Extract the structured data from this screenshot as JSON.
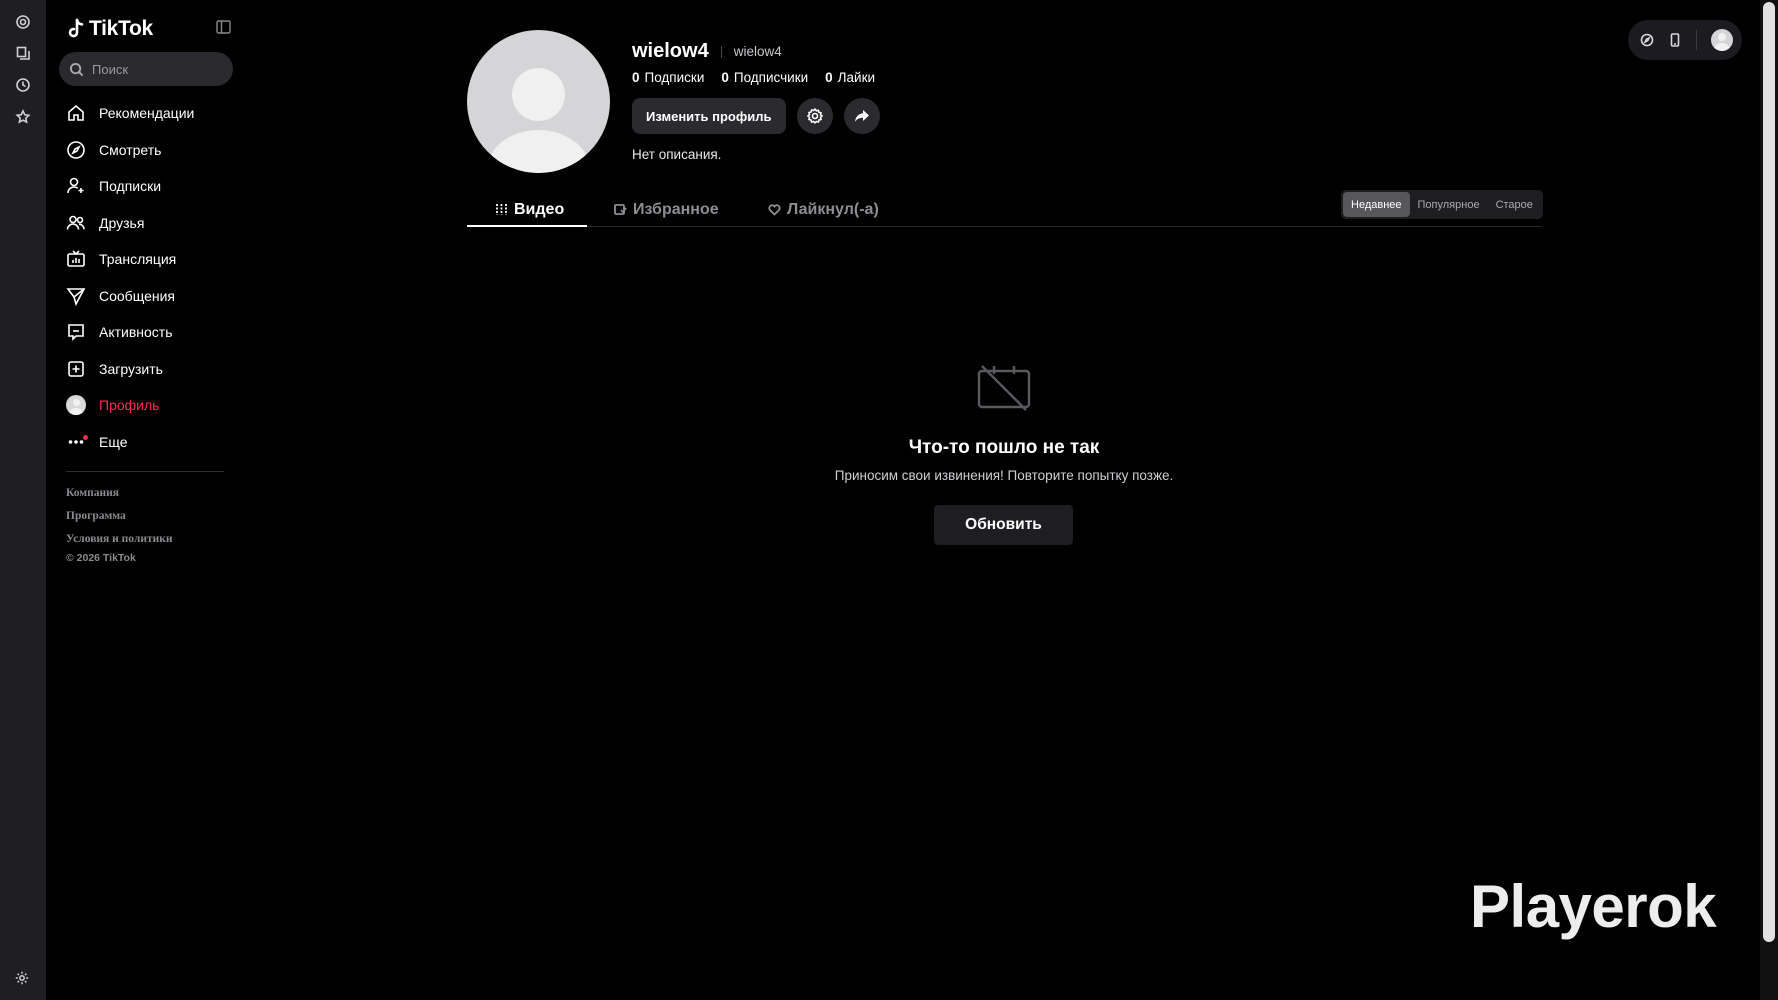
{
  "sidebar": {
    "logo_text": "TikTok",
    "search_placeholder": "Поиск",
    "items": [
      {
        "label": "Рекомендации"
      },
      {
        "label": "Смотреть"
      },
      {
        "label": "Подписки"
      },
      {
        "label": "Друзья"
      },
      {
        "label": "Трансляция"
      },
      {
        "label": "Сообщения"
      },
      {
        "label": "Активность"
      },
      {
        "label": "Загрузить"
      },
      {
        "label": "Профиль"
      },
      {
        "label": "Еще"
      }
    ],
    "footer_links": [
      "Компания",
      "Программа",
      "Условия и политики"
    ],
    "copyright": "© 2026 TikTok"
  },
  "profile": {
    "username": "wielow4",
    "nickname": "wielow4",
    "following_count": "0",
    "following_label": "Подписки",
    "followers_count": "0",
    "followers_label": "Подписчики",
    "likes_count": "0",
    "likes_label": "Лайки",
    "edit_label": "Изменить профиль",
    "bio": "Нет описания."
  },
  "tabs": [
    {
      "label": "Видео"
    },
    {
      "label": "Избранное"
    },
    {
      "label": "Лайкнул(-а)"
    }
  ],
  "sort": {
    "options": [
      "Недавнее",
      "Популярное",
      "Старое"
    ],
    "selected": "Недавнее"
  },
  "error": {
    "title": "Что-то пошло не так",
    "subtitle": "Приносим свои извинения! Повторите попытку позже.",
    "button": "Обновить"
  },
  "watermark": "Playerok",
  "colors": {
    "accent": "#fe2c55",
    "background": "#000000",
    "surface": "#2b2b2f"
  }
}
